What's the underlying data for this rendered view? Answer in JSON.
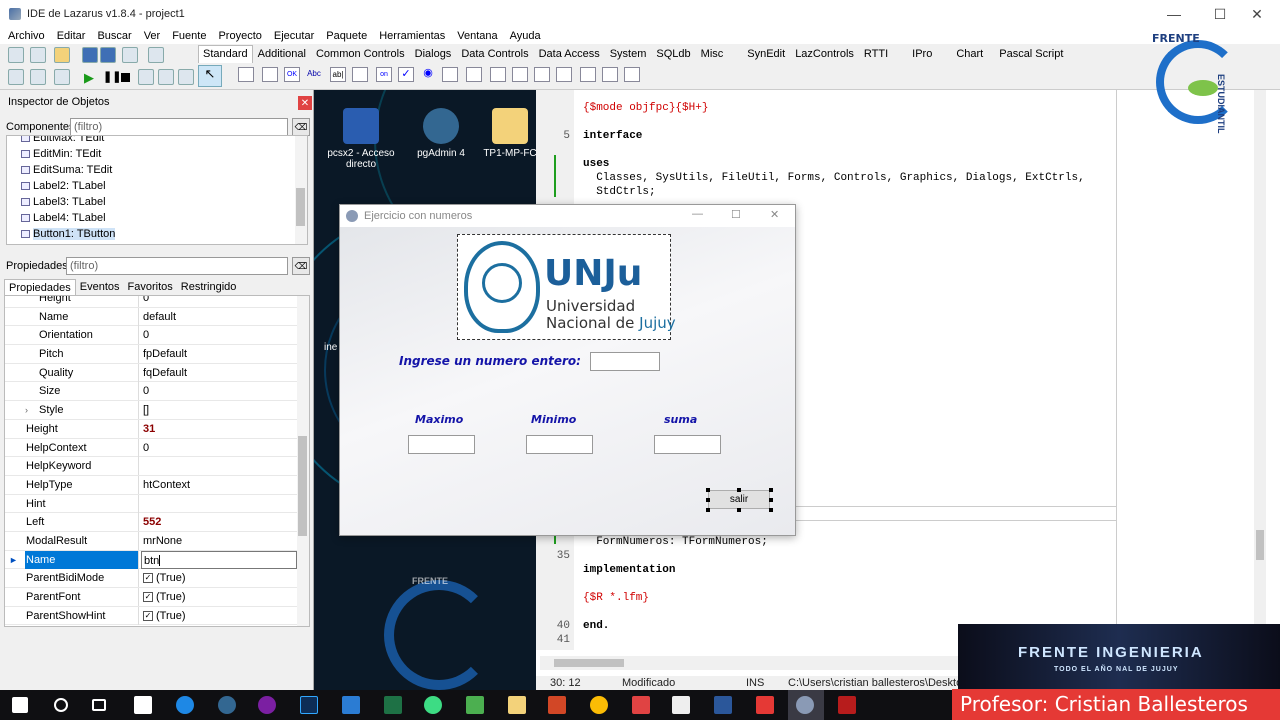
{
  "window": {
    "title": "IDE de Lazarus v1.8.4 - project1"
  },
  "menu": [
    "Archivo",
    "Editar",
    "Buscar",
    "Ver",
    "Fuente",
    "Proyecto",
    "Ejecutar",
    "Paquete",
    "Herramientas",
    "Ventana",
    "Ayuda"
  ],
  "palette_tabs": [
    "Standard",
    "Additional",
    "Common Controls",
    "Dialogs",
    "Data Controls",
    "Data Access",
    "System",
    "SQLdb",
    "Misc",
    "SynEdit",
    "LazControls",
    "RTTI",
    "IPro",
    "Chart",
    "Pascal Script"
  ],
  "inspector": {
    "title": "Inspector de Objetos",
    "components_label": "Componentes",
    "filter_placeholder": "(filtro)",
    "tree": [
      "EditMax: TEdit",
      "EditMin: TEdit",
      "EditSuma: TEdit",
      "Label2: TLabel",
      "Label3: TLabel",
      "Label4: TLabel",
      "Button1: TButton"
    ],
    "props_label": "Propiedades",
    "props_filter_placeholder": "(filtro)",
    "tabs": [
      "Propiedades",
      "Eventos",
      "Favoritos",
      "Restringido"
    ],
    "rows": [
      {
        "name": "Height",
        "value": "0",
        "sub": true
      },
      {
        "name": "Name",
        "value": "default",
        "sub": true
      },
      {
        "name": "Orientation",
        "value": "0",
        "sub": true
      },
      {
        "name": "Pitch",
        "value": "fpDefault",
        "sub": true
      },
      {
        "name": "Quality",
        "value": "fqDefault",
        "sub": true
      },
      {
        "name": "Size",
        "value": "0",
        "sub": true
      },
      {
        "name": "Style",
        "value": "[]",
        "sub": true,
        "arrow": true
      },
      {
        "name": "Height",
        "value": "31",
        "bold": true
      },
      {
        "name": "HelpContext",
        "value": "0"
      },
      {
        "name": "HelpKeyword",
        "value": ""
      },
      {
        "name": "HelpType",
        "value": "htContext"
      },
      {
        "name": "Hint",
        "value": ""
      },
      {
        "name": "Left",
        "value": "552",
        "bold": true
      },
      {
        "name": "ModalResult",
        "value": "mrNone"
      },
      {
        "name": "Name",
        "value": "btn",
        "selected": true
      },
      {
        "name": "ParentBidiMode",
        "value": "(True)",
        "check": true
      },
      {
        "name": "ParentFont",
        "value": "(True)",
        "check": true
      },
      {
        "name": "ParentShowHint",
        "value": "(True)",
        "check": true
      }
    ]
  },
  "desktop_icons": [
    {
      "label": "pcsx2 - Acceso directo"
    },
    {
      "label": "pgAdmin 4"
    },
    {
      "label": "TP1-MP-FC"
    }
  ],
  "desktop_partial_text": "ine",
  "editor": {
    "lines": [
      {
        "n": "",
        "text": "{$mode objfpc}{$H+}",
        "cls": "dir"
      },
      {
        "n": "5",
        "text": "interface",
        "cls": "kw"
      },
      {
        "n": "",
        "text": "uses",
        "cls": "kw"
      },
      {
        "n": "",
        "text": "  Classes, SysUtils, FileUtil, Forms, Controls, Graphics, Dialogs, ExtCtrls,",
        "cls": ""
      },
      {
        "n": "",
        "text": "  StdCtrls;",
        "cls": ""
      },
      {
        "n": "",
        "text": "  FormNumeros: TFormNumeros;",
        "cls": ""
      },
      {
        "n": "35",
        "text": "",
        "cls": ""
      },
      {
        "n": "",
        "text": "implementation",
        "cls": "kw"
      },
      {
        "n": "",
        "text": "{$R *.lfm}",
        "cls": "dir"
      },
      {
        "n": "40",
        "text": "end.",
        "cls": "kw"
      },
      {
        "n": "41",
        "text": "",
        "cls": ""
      }
    ],
    "status": {
      "pos": "30: 12",
      "state": "Modificado",
      "mode": "INS",
      "path": "C:\\Users\\cristian ballesteros\\Desktop\\T"
    }
  },
  "form": {
    "title": "Ejercicio con numeros",
    "logo_text": "UNJu",
    "logo_line1": "Universidad",
    "logo_line2": "Nacional de ",
    "logo_line2b": "Jujuy",
    "prompt": "Ingrese un numero entero:",
    "label_max": "Maximo",
    "label_min": "Minimo",
    "label_sum": "suma",
    "button": "salir"
  },
  "watermark": {
    "top": "FRENTE",
    "side": "ESTUDIANTIL"
  },
  "brand": {
    "text": "FRENTE INGENIERIA",
    "sub": "TODO EL AÑO NAL DE JUJUY"
  },
  "banner": {
    "text": "Profesor: Cristian Ballesteros"
  },
  "colors": {
    "accent": "#0078d7",
    "form_label": "#1414a8",
    "banner": "#e53935"
  }
}
